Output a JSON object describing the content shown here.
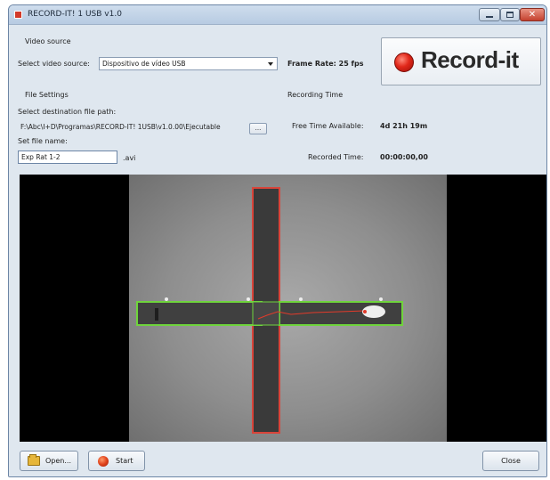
{
  "window": {
    "title": "RECORD-IT! 1 USB v1.0"
  },
  "video_source": {
    "section_label": "Video source",
    "select_label": "Select video source:",
    "selected": "Dispositivo de vídeo USB"
  },
  "frame_rate": {
    "text": "Frame Rate: 25 fps"
  },
  "record_button": {
    "label": "Record-it"
  },
  "file_settings": {
    "section_label": "File Settings",
    "path_label": "Select destination file path:",
    "path_value": "F:\\Abc\\I+D\\Programas\\RECORD-IT! 1USB\\v1.0.00\\Ejecutable",
    "browse_label": "...",
    "name_label": "Set file name:",
    "name_value": "Exp Rat 1-2",
    "extension": ".avi"
  },
  "recording_time": {
    "section_label": "Recording Time",
    "free_label": "Free Time Available:",
    "free_value": "4d 21h 19m",
    "recorded_label": "Recorded Time:",
    "recorded_value": "00:00:00,00"
  },
  "buttons": {
    "open": "Open...",
    "start": "Start",
    "close": "Close"
  },
  "icons": {
    "app": "app-icon",
    "open": "folder-icon",
    "start": "record-dot-icon"
  },
  "colors": {
    "accent_red": "#e1281a",
    "zone_green": "#6fd43c",
    "zone_red": "#d8443a"
  }
}
